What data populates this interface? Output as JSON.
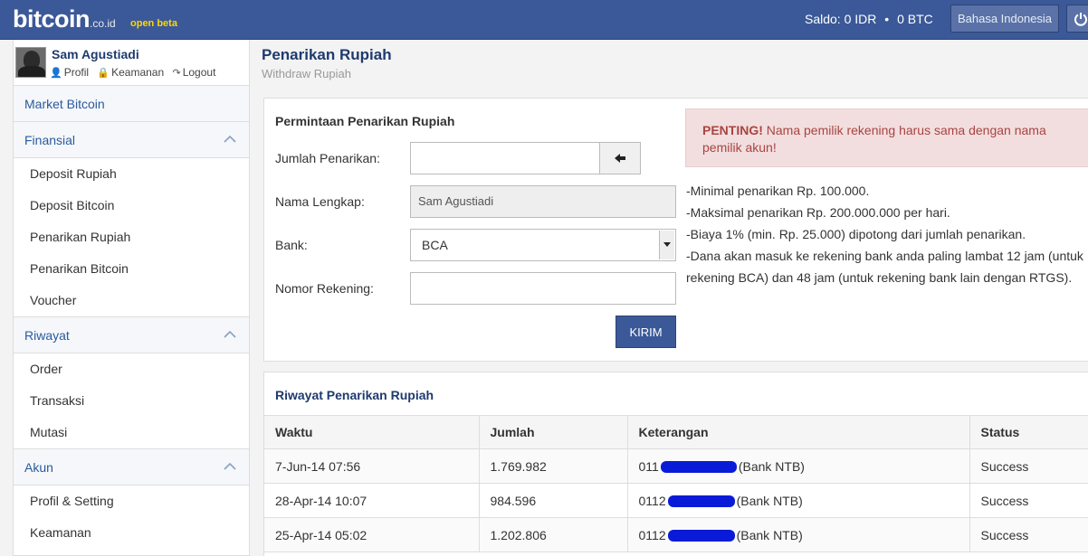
{
  "topbar": {
    "logo_main": "bitcoin",
    "logo_domain": ".co.id",
    "logo_tag": "open beta",
    "saldo_label": "Saldo:",
    "saldo_idr": "0 IDR",
    "saldo_btc": "0 BTC",
    "language": "Bahasa Indonesia",
    "accent": "#3b5998"
  },
  "user": {
    "name": "Sam Agustiadi",
    "links": [
      "Profil",
      "Keamanan",
      "Logout"
    ]
  },
  "sidebar": {
    "top_item": "Market Bitcoin",
    "sections": [
      {
        "label": "Finansial",
        "items": [
          "Deposit Rupiah",
          "Deposit Bitcoin",
          "Penarikan Rupiah",
          "Penarikan Bitcoin",
          "Voucher"
        ]
      },
      {
        "label": "Riwayat",
        "items": [
          "Order",
          "Transaksi",
          "Mutasi"
        ]
      },
      {
        "label": "Akun",
        "items": [
          "Profil & Setting",
          "Keamanan"
        ]
      }
    ]
  },
  "page": {
    "title": "Penarikan Rupiah",
    "subtitle": "Withdraw Rupiah"
  },
  "form": {
    "title": "Permintaan Penarikan Rupiah",
    "amount_label": "Jumlah Penarikan:",
    "amount_value": "",
    "name_label": "Nama Lengkap:",
    "name_value": "Sam Agustiadi",
    "bank_label": "Bank:",
    "bank_value": "BCA",
    "account_label": "Nomor Rekening:",
    "account_value": "",
    "submit": "KIRIM"
  },
  "alert": {
    "strong": "PENTING!",
    "text": " Nama pemilik rekening harus sama dengan nama pemilik akun!"
  },
  "notes": [
    "-Minimal penarikan Rp. 100.000.",
    "-Maksimal penarikan Rp. 200.000.000 per hari.",
    "-Biaya 1% (min. Rp. 25.000) dipotong dari jumlah penarikan.",
    "-Dana akan masuk ke rekening bank anda paling lambat 12 jam (untuk rekening BCA) dan 48 jam (untuk rekening bank lain dengan RTGS)."
  ],
  "history": {
    "title": "Riwayat Penarikan Rupiah",
    "columns": [
      "Waktu",
      "Jumlah",
      "Keterangan",
      "Status"
    ],
    "rows": [
      {
        "waktu": "7-Jun-14 07:56",
        "jumlah": "1.769.982",
        "ket_prefix": "011",
        "ket_suffix": "(Bank NTB)",
        "status": "Success"
      },
      {
        "waktu": "28-Apr-14 10:07",
        "jumlah": "984.596",
        "ket_prefix": "0112",
        "ket_suffix": "(Bank NTB)",
        "status": "Success"
      },
      {
        "waktu": "25-Apr-14 05:02",
        "jumlah": "1.202.806",
        "ket_prefix": "0112",
        "ket_suffix": "(Bank NTB)",
        "status": "Success"
      }
    ]
  }
}
